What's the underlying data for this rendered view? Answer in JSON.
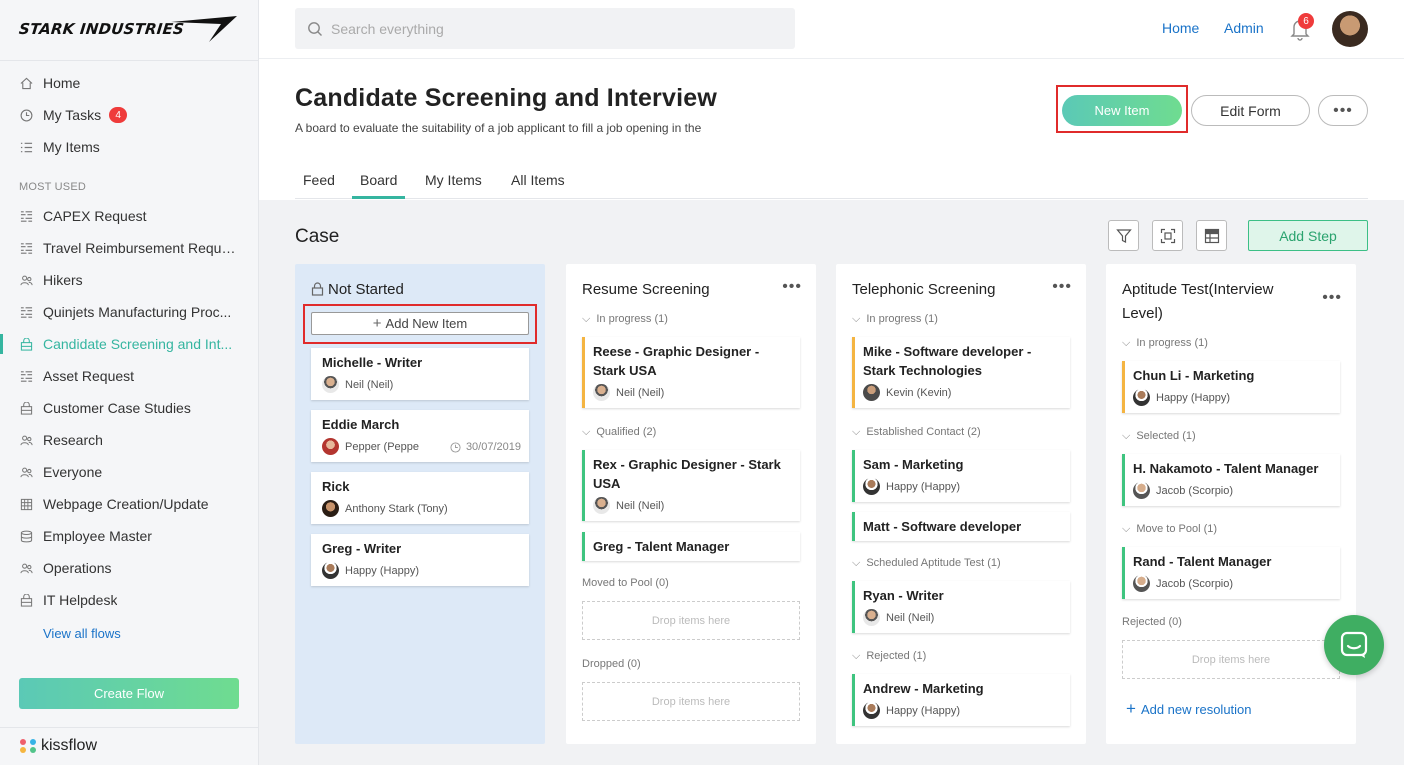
{
  "brand": {
    "logo_text": "STARK INDUSTRIES",
    "footer": "kissflow"
  },
  "sidebar": {
    "items": [
      {
        "label": "Home",
        "icon": "home-icon"
      },
      {
        "label": "My Tasks",
        "icon": "clock-icon",
        "badge": "4"
      },
      {
        "label": "My Items",
        "icon": "list-icon"
      }
    ],
    "section_label": "MOST USED",
    "flows": [
      {
        "label": "CAPEX Request",
        "icon": "flow-icon"
      },
      {
        "label": "Travel Reimbursement Reque...",
        "icon": "flow-icon"
      },
      {
        "label": "Hikers",
        "icon": "people-icon"
      },
      {
        "label": "Quinjets Manufacturing Proc...",
        "icon": "flow-icon"
      },
      {
        "label": "Candidate Screening and Int...",
        "icon": "board-icon",
        "active": true
      },
      {
        "label": "Asset Request",
        "icon": "flow-icon"
      },
      {
        "label": "Customer Case Studies",
        "icon": "board-icon"
      },
      {
        "label": "Research",
        "icon": "people-icon"
      },
      {
        "label": "Everyone",
        "icon": "people-icon"
      },
      {
        "label": "Webpage Creation/Update",
        "icon": "grid-icon"
      },
      {
        "label": "Employee Master",
        "icon": "database-icon"
      },
      {
        "label": "Operations",
        "icon": "people-icon"
      },
      {
        "label": "IT Helpdesk",
        "icon": "board-icon"
      }
    ],
    "view_all": "View all flows",
    "create_flow": "Create Flow"
  },
  "topbar": {
    "search_placeholder": "Search everything",
    "links": [
      "Home",
      "Admin"
    ],
    "notification_count": "6"
  },
  "page": {
    "title": "Candidate Screening and Interview",
    "description": "A board to evaluate the suitability of a job applicant to fill a job opening in the",
    "new_item": "New Item",
    "edit_form": "Edit Form",
    "more": "•••",
    "tabs": [
      "Feed",
      "Board",
      "My Items",
      "All Items"
    ],
    "active_tab": "Board"
  },
  "board": {
    "title": "Case",
    "add_step": "Add Step",
    "add_new_item": "Add New Item",
    "drop_text": "Drop items here",
    "add_resolution": "Add new resolution",
    "columns": [
      {
        "title": "Not Started",
        "cards": [
          {
            "title": "Michelle - Writer",
            "person": "Neil (Neil)"
          },
          {
            "title": "Eddie March",
            "person": "Pepper (Peppe",
            "due": "30/07/2019"
          },
          {
            "title": "Rick",
            "person": "Anthony Stark (Tony)"
          },
          {
            "title": "Greg - Writer",
            "person": "Happy (Happy)"
          }
        ]
      },
      {
        "title": "Resume Screening",
        "groups": [
          {
            "label": "In progress",
            "count": "(1)",
            "cards": [
              {
                "title": "Reese - Graphic Designer - Stark USA",
                "person": "Neil (Neil)"
              }
            ]
          },
          {
            "label": "Qualified",
            "count": "(2)",
            "cards": [
              {
                "title": "Rex - Graphic Designer - Stark USA",
                "person": "Neil (Neil)"
              },
              {
                "title": "Greg - Talent Manager"
              }
            ]
          },
          {
            "label": "Moved to Pool",
            "count": "(0)"
          },
          {
            "label": "Dropped",
            "count": "(0)"
          }
        ]
      },
      {
        "title": "Telephonic Screening",
        "groups": [
          {
            "label": "In progress",
            "count": "(1)",
            "cards": [
              {
                "title": "Mike - Software developer - Stark Technologies",
                "person": "Kevin (Kevin)"
              }
            ]
          },
          {
            "label": "Established Contact",
            "count": "(2)",
            "cards": [
              {
                "title": "Sam - Marketing",
                "person": "Happy (Happy)"
              },
              {
                "title": "Matt - Software developer"
              }
            ]
          },
          {
            "label": "Scheduled Aptitude Test",
            "count": "(1)",
            "cards": [
              {
                "title": "Ryan - Writer",
                "person": "Neil (Neil)"
              }
            ]
          },
          {
            "label": "Rejected",
            "count": "(1)",
            "cards": [
              {
                "title": "Andrew - Marketing",
                "person": "Happy (Happy)"
              }
            ]
          }
        ]
      },
      {
        "title": "Aptitude Test(Interview Level)",
        "groups": [
          {
            "label": "In progress",
            "count": "(1)",
            "cards": [
              {
                "title": "Chun Li - Marketing",
                "person": "Happy (Happy)"
              }
            ]
          },
          {
            "label": "Selected",
            "count": "(1)",
            "cards": [
              {
                "title": "H. Nakamoto - Talent Manager",
                "person": "Jacob (Scorpio)"
              }
            ]
          },
          {
            "label": "Move to Pool",
            "count": "(1)",
            "cards": [
              {
                "title": "Rand - Talent Manager",
                "person": "Jacob (Scorpio)"
              }
            ]
          },
          {
            "label": "Rejected",
            "count": "(0)"
          }
        ]
      }
    ]
  },
  "colors": {
    "accent": "#35b5a0",
    "highlight": "#e02b2b",
    "link": "#1a73c8",
    "badge": "#ef3b3b"
  }
}
